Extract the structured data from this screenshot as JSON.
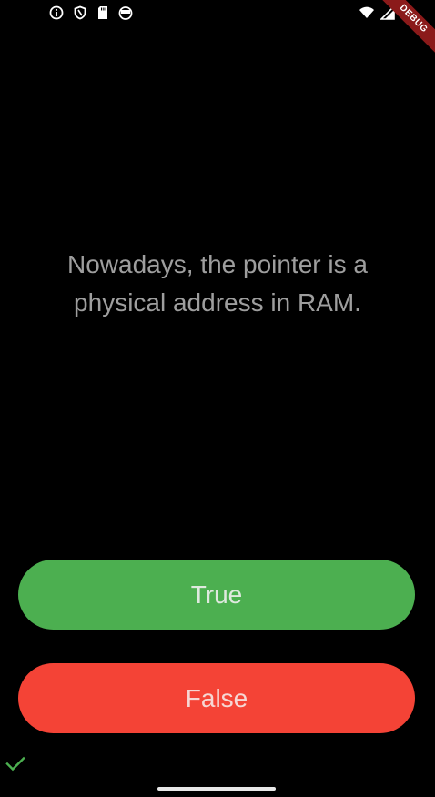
{
  "status_bar": {
    "left_icons": [
      "info-icon",
      "shield-icon",
      "sd-card-icon",
      "android-icon"
    ],
    "right_icons": [
      "wifi-icon",
      "signal-icon"
    ],
    "debug_label": "DEBUG"
  },
  "quiz": {
    "question": "Nowadays, the pointer is a physical address in RAM.",
    "true_label": "True",
    "false_label": "False",
    "colors": {
      "true": "#4caf50",
      "false": "#f44336",
      "check": "#4caf50"
    }
  },
  "score_keeper": {
    "marks": [
      "check-icon"
    ]
  }
}
